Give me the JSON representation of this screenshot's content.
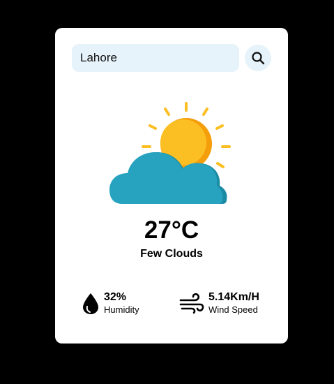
{
  "search": {
    "value": "Lahore",
    "placeholder": ""
  },
  "weather": {
    "icon": "sun-behind-cloud-icon",
    "temperature": "27°C",
    "condition": "Few Clouds"
  },
  "stats": {
    "humidity": {
      "value": "32%",
      "label": "Humidity",
      "icon": "water-drop-icon"
    },
    "wind": {
      "value": "5.14Km/H",
      "label": "Wind Speed",
      "icon": "wind-icon"
    }
  },
  "colors": {
    "background": "#000000",
    "card": "#ffffff",
    "search_bg": "#e6f3fa",
    "sun": "#fbbf24",
    "cloud": "#27a3bf"
  }
}
